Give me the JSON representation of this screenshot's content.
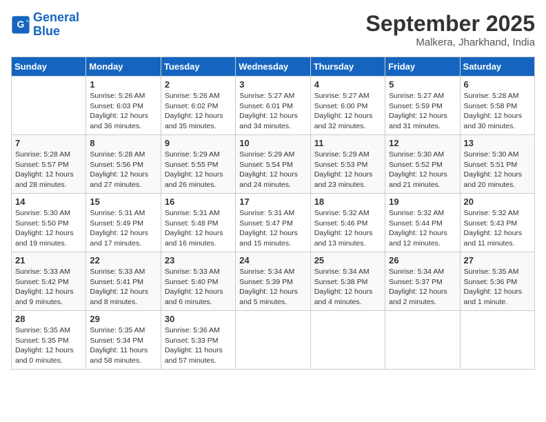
{
  "logo": {
    "line1": "General",
    "line2": "Blue"
  },
  "title": "September 2025",
  "subtitle": "Malkera, Jharkhand, India",
  "days_of_week": [
    "Sunday",
    "Monday",
    "Tuesday",
    "Wednesday",
    "Thursday",
    "Friday",
    "Saturday"
  ],
  "weeks": [
    [
      {
        "day": "",
        "info": ""
      },
      {
        "day": "1",
        "info": "Sunrise: 5:26 AM\nSunset: 6:03 PM\nDaylight: 12 hours\nand 36 minutes."
      },
      {
        "day": "2",
        "info": "Sunrise: 5:26 AM\nSunset: 6:02 PM\nDaylight: 12 hours\nand 35 minutes."
      },
      {
        "day": "3",
        "info": "Sunrise: 5:27 AM\nSunset: 6:01 PM\nDaylight: 12 hours\nand 34 minutes."
      },
      {
        "day": "4",
        "info": "Sunrise: 5:27 AM\nSunset: 6:00 PM\nDaylight: 12 hours\nand 32 minutes."
      },
      {
        "day": "5",
        "info": "Sunrise: 5:27 AM\nSunset: 5:59 PM\nDaylight: 12 hours\nand 31 minutes."
      },
      {
        "day": "6",
        "info": "Sunrise: 5:28 AM\nSunset: 5:58 PM\nDaylight: 12 hours\nand 30 minutes."
      }
    ],
    [
      {
        "day": "7",
        "info": "Sunrise: 5:28 AM\nSunset: 5:57 PM\nDaylight: 12 hours\nand 28 minutes."
      },
      {
        "day": "8",
        "info": "Sunrise: 5:28 AM\nSunset: 5:56 PM\nDaylight: 12 hours\nand 27 minutes."
      },
      {
        "day": "9",
        "info": "Sunrise: 5:29 AM\nSunset: 5:55 PM\nDaylight: 12 hours\nand 26 minutes."
      },
      {
        "day": "10",
        "info": "Sunrise: 5:29 AM\nSunset: 5:54 PM\nDaylight: 12 hours\nand 24 minutes."
      },
      {
        "day": "11",
        "info": "Sunrise: 5:29 AM\nSunset: 5:53 PM\nDaylight: 12 hours\nand 23 minutes."
      },
      {
        "day": "12",
        "info": "Sunrise: 5:30 AM\nSunset: 5:52 PM\nDaylight: 12 hours\nand 21 minutes."
      },
      {
        "day": "13",
        "info": "Sunrise: 5:30 AM\nSunset: 5:51 PM\nDaylight: 12 hours\nand 20 minutes."
      }
    ],
    [
      {
        "day": "14",
        "info": "Sunrise: 5:30 AM\nSunset: 5:50 PM\nDaylight: 12 hours\nand 19 minutes."
      },
      {
        "day": "15",
        "info": "Sunrise: 5:31 AM\nSunset: 5:49 PM\nDaylight: 12 hours\nand 17 minutes."
      },
      {
        "day": "16",
        "info": "Sunrise: 5:31 AM\nSunset: 5:48 PM\nDaylight: 12 hours\nand 16 minutes."
      },
      {
        "day": "17",
        "info": "Sunrise: 5:31 AM\nSunset: 5:47 PM\nDaylight: 12 hours\nand 15 minutes."
      },
      {
        "day": "18",
        "info": "Sunrise: 5:32 AM\nSunset: 5:46 PM\nDaylight: 12 hours\nand 13 minutes."
      },
      {
        "day": "19",
        "info": "Sunrise: 5:32 AM\nSunset: 5:44 PM\nDaylight: 12 hours\nand 12 minutes."
      },
      {
        "day": "20",
        "info": "Sunrise: 5:32 AM\nSunset: 5:43 PM\nDaylight: 12 hours\nand 11 minutes."
      }
    ],
    [
      {
        "day": "21",
        "info": "Sunrise: 5:33 AM\nSunset: 5:42 PM\nDaylight: 12 hours\nand 9 minutes."
      },
      {
        "day": "22",
        "info": "Sunrise: 5:33 AM\nSunset: 5:41 PM\nDaylight: 12 hours\nand 8 minutes."
      },
      {
        "day": "23",
        "info": "Sunrise: 5:33 AM\nSunset: 5:40 PM\nDaylight: 12 hours\nand 6 minutes."
      },
      {
        "day": "24",
        "info": "Sunrise: 5:34 AM\nSunset: 5:39 PM\nDaylight: 12 hours\nand 5 minutes."
      },
      {
        "day": "25",
        "info": "Sunrise: 5:34 AM\nSunset: 5:38 PM\nDaylight: 12 hours\nand 4 minutes."
      },
      {
        "day": "26",
        "info": "Sunrise: 5:34 AM\nSunset: 5:37 PM\nDaylight: 12 hours\nand 2 minutes."
      },
      {
        "day": "27",
        "info": "Sunrise: 5:35 AM\nSunset: 5:36 PM\nDaylight: 12 hours\nand 1 minute."
      }
    ],
    [
      {
        "day": "28",
        "info": "Sunrise: 5:35 AM\nSunset: 5:35 PM\nDaylight: 12 hours\nand 0 minutes."
      },
      {
        "day": "29",
        "info": "Sunrise: 5:35 AM\nSunset: 5:34 PM\nDaylight: 11 hours\nand 58 minutes."
      },
      {
        "day": "30",
        "info": "Sunrise: 5:36 AM\nSunset: 5:33 PM\nDaylight: 11 hours\nand 57 minutes."
      },
      {
        "day": "",
        "info": ""
      },
      {
        "day": "",
        "info": ""
      },
      {
        "day": "",
        "info": ""
      },
      {
        "day": "",
        "info": ""
      }
    ]
  ]
}
